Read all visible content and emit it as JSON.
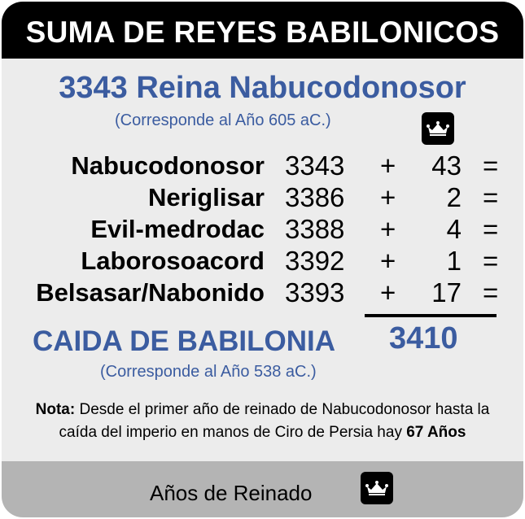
{
  "header": {
    "title": "SUMA DE REYES BABILONICOS"
  },
  "intro": {
    "title": "3343 Reina Nabucodonosor",
    "note": "(Corresponde al Año 605 aC.)"
  },
  "icons": {
    "crown": "crown-icon"
  },
  "colors": {
    "accent": "#3b5ca0",
    "header_bg": "#000000",
    "panel_bg": "#ececec",
    "footer_bg": "#b4b4b4"
  },
  "reigns": [
    {
      "king": "Nabucodonosor",
      "year": "3343",
      "op": "+",
      "years": "43",
      "eq": "="
    },
    {
      "king": "Neriglisar",
      "year": "3386",
      "op": "+",
      "years": "2",
      "eq": "="
    },
    {
      "king": "Evil-medrodac",
      "year": "3388",
      "op": "+",
      "years": "4",
      "eq": "="
    },
    {
      "king": "Laborosoacord",
      "year": "3392",
      "op": "+",
      "years": "1",
      "eq": "="
    },
    {
      "king": "Belsasar/Nabonido",
      "year": "3393",
      "op": "+",
      "years": "17",
      "eq": "="
    }
  ],
  "result": {
    "title": "CAIDA DE BABILONIA",
    "total": "3410",
    "note": "(Corresponde al Año 538 aC.)"
  },
  "footnote": {
    "label": "Nota:",
    "text_1": " Desde el primer año de reinado de Nabucodonosor hasta la caída del imperio en manos de Ciro de Persia hay ",
    "emphasis": "67 Años"
  },
  "footer": {
    "legend_label": "Años de Reinado"
  }
}
